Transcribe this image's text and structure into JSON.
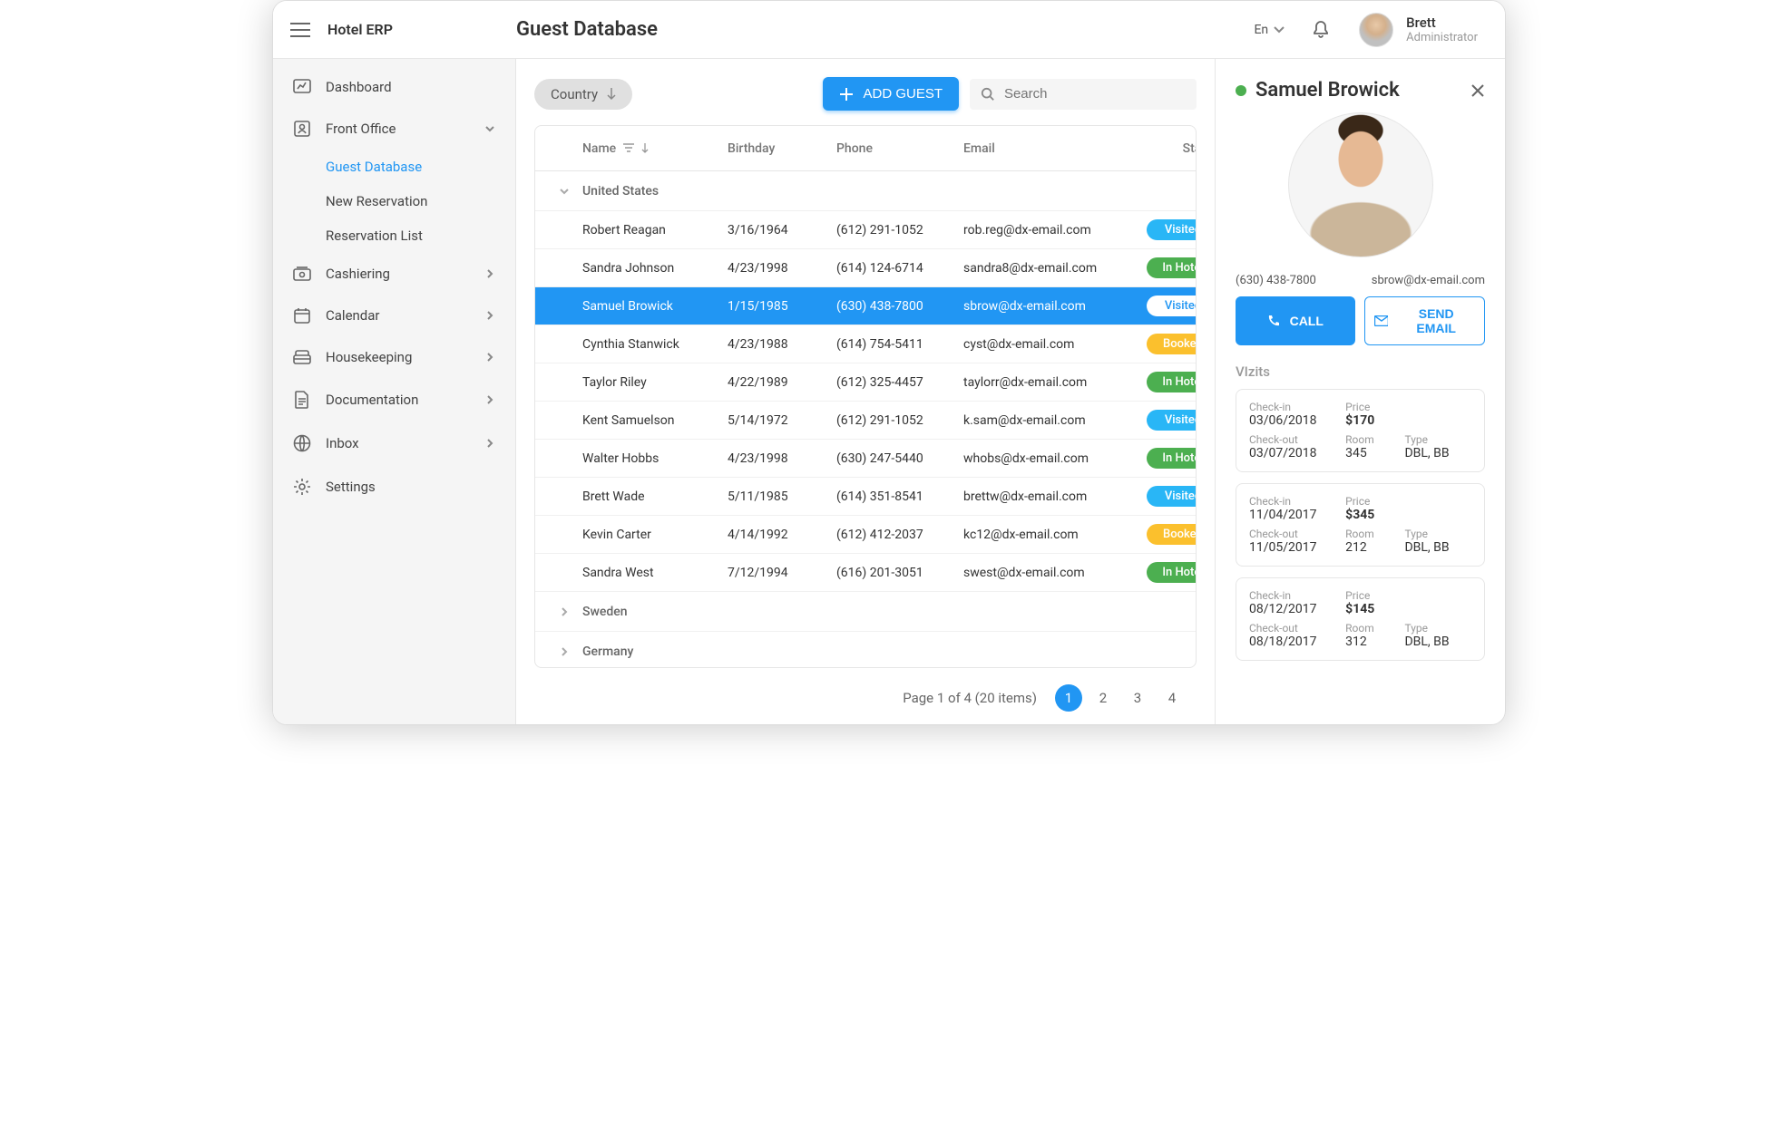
{
  "brand": "Hotel ERP",
  "page_title": "Guest Database",
  "lang": "En",
  "user": {
    "name": "Brett",
    "role": "Administrator"
  },
  "sidebar": {
    "items": [
      {
        "icon": "dashboard",
        "label": "Dashboard",
        "expandable": false
      },
      {
        "icon": "front-office",
        "label": "Front Office",
        "expandable": true,
        "expanded": true,
        "children": [
          {
            "label": "Guest Database",
            "active": true
          },
          {
            "label": "New Reservation"
          },
          {
            "label": "Reservation List"
          }
        ]
      },
      {
        "icon": "cashiering",
        "label": "Cashiering",
        "expandable": true
      },
      {
        "icon": "calendar",
        "label": "Calendar",
        "expandable": true
      },
      {
        "icon": "housekeeping",
        "label": "Housekeeping",
        "expandable": true
      },
      {
        "icon": "document",
        "label": "Documentation",
        "expandable": true
      },
      {
        "icon": "globe",
        "label": "Inbox",
        "expandable": true
      },
      {
        "icon": "gear",
        "label": "Settings",
        "expandable": false
      }
    ]
  },
  "toolbar": {
    "group_chip": "Country",
    "add_button": "ADD GUEST",
    "search_placeholder": "Search"
  },
  "table": {
    "headers": {
      "name": "Name",
      "birthday": "Birthday",
      "phone": "Phone",
      "email": "Email",
      "status": "Status"
    },
    "groups": [
      {
        "name": "United States",
        "expanded": true,
        "rows": [
          {
            "name": "Robert Reagan",
            "birthday": "3/16/1964",
            "phone": "(612) 291-1052",
            "email": "rob.reg@dx-email.com",
            "status": "Visited"
          },
          {
            "name": "Sandra Johnson",
            "birthday": "4/23/1998",
            "phone": "(614) 124-6714",
            "email": "sandra8@dx-email.com",
            "status": "In Hotel"
          },
          {
            "name": "Samuel Browick",
            "birthday": "1/15/1985",
            "phone": "(630) 438-7800",
            "email": "sbrow@dx-email.com",
            "status": "Visited",
            "selected": true
          },
          {
            "name": "Cynthia Stanwick",
            "birthday": "4/23/1988",
            "phone": "(614) 754-5411",
            "email": "cyst@dx-email.com",
            "status": "Booked"
          },
          {
            "name": "Taylor Riley",
            "birthday": "4/22/1989",
            "phone": "(612) 325-4457",
            "email": "taylorr@dx-email.com",
            "status": "In Hotel"
          },
          {
            "name": "Kent Samuelson",
            "birthday": "5/14/1972",
            "phone": "(612) 291-1052",
            "email": "k.sam@dx-email.com",
            "status": "Visited"
          },
          {
            "name": "Walter Hobbs",
            "birthday": "4/23/1998",
            "phone": "(630) 247-5440",
            "email": "whobs@dx-email.com",
            "status": "In Hotel"
          },
          {
            "name": "Brett Wade",
            "birthday": "5/11/1985",
            "phone": "(614) 351-8541",
            "email": "brettw@dx-email.com",
            "status": "Visited"
          },
          {
            "name": "Kevin Carter",
            "birthday": "4/14/1992",
            "phone": "(612) 412-2037",
            "email": "kc12@dx-email.com",
            "status": "Booked"
          },
          {
            "name": "Sandra West",
            "birthday": "7/12/1994",
            "phone": "(616) 201-3051",
            "email": "swest@dx-email.com",
            "status": "In Hotel"
          }
        ]
      },
      {
        "name": "Sweden",
        "expanded": false
      },
      {
        "name": "Germany",
        "expanded": false
      }
    ]
  },
  "pager": {
    "summary": "Page 1 of 4 (20 items)",
    "pages": [
      "1",
      "2",
      "3",
      "4"
    ],
    "active": 0
  },
  "detail": {
    "name": "Samuel Browick",
    "phone": "(630) 438-7800",
    "email": "sbrow@dx-email.com",
    "call_label": "CALL",
    "email_label": "SEND EMAIL",
    "visits_label": "VIzits",
    "labels": {
      "checkin": "Check-in",
      "checkout": "Check-out",
      "price": "Price",
      "room": "Room",
      "type": "Type"
    },
    "visits": [
      {
        "checkin": "03/06/2018",
        "checkout": "03/07/2018",
        "price": "$170",
        "room": "345",
        "type": "DBL, BB"
      },
      {
        "checkin": "11/04/2017",
        "checkout": "11/05/2017",
        "price": "$345",
        "room": "212",
        "type": "DBL, BB"
      },
      {
        "checkin": "08/12/2017",
        "checkout": "08/18/2017",
        "price": "$145",
        "room": "312",
        "type": "DBL, BB"
      }
    ]
  }
}
